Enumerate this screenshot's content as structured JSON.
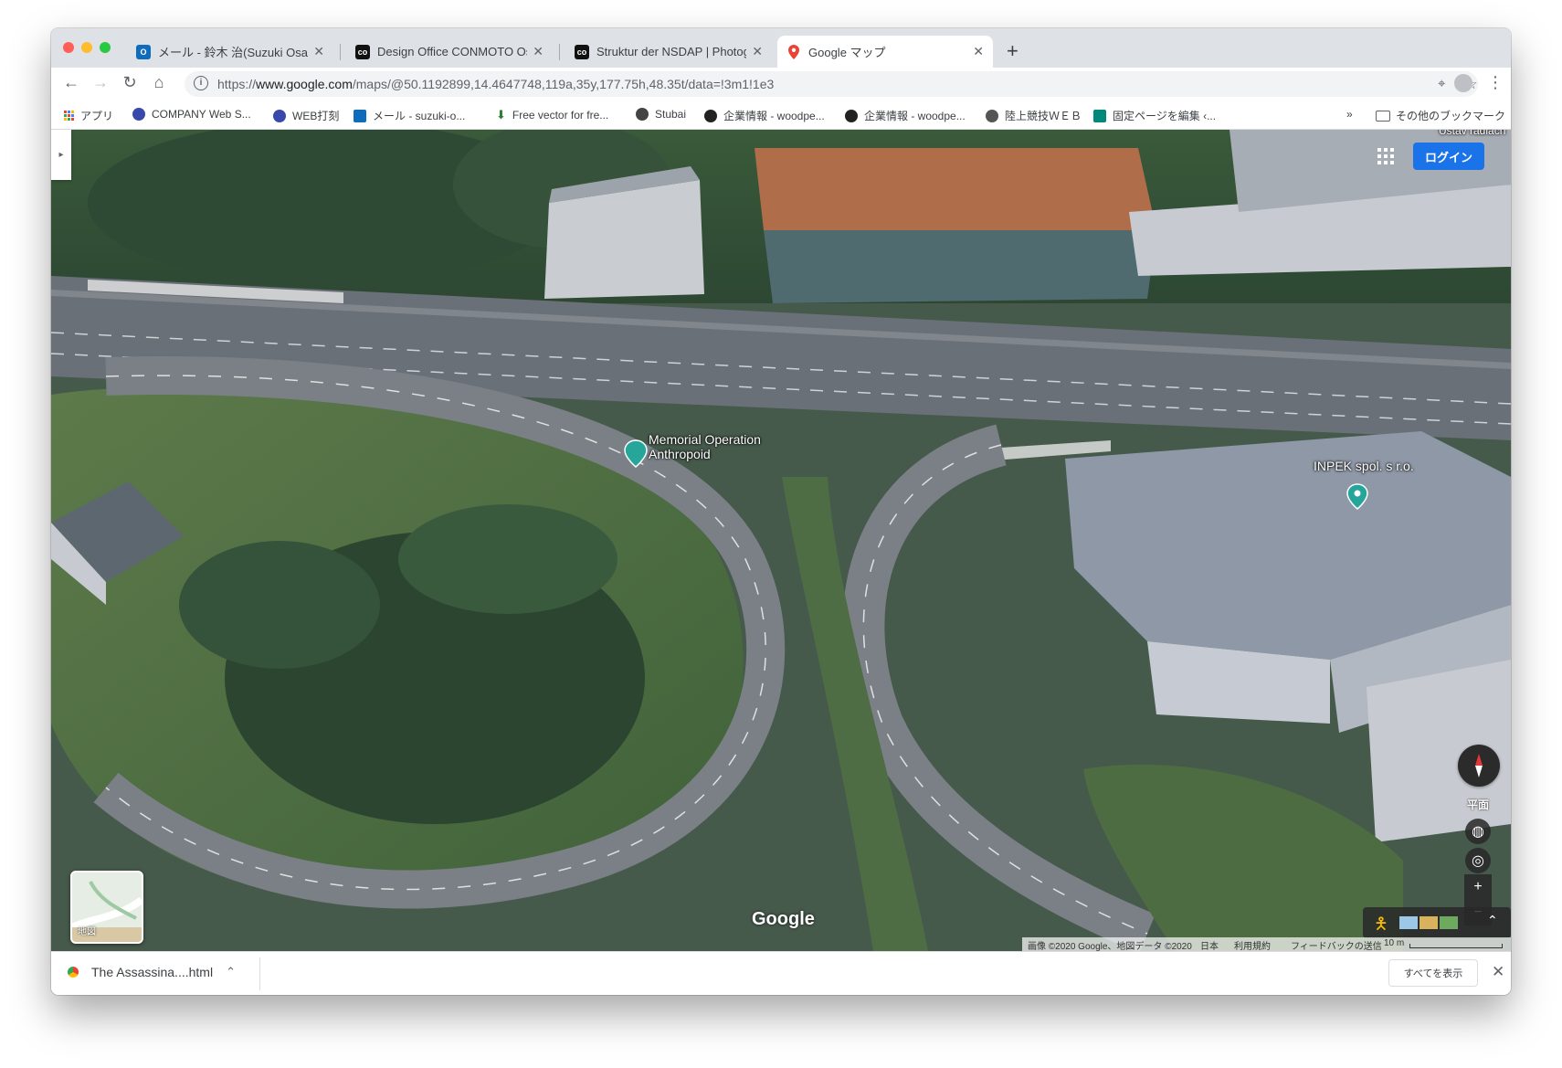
{
  "tabs": [
    {
      "title": "メール - 鈴木 治(Suzuki Osamu)",
      "icon": "outlook-icon",
      "color": "#0f6cbd"
    },
    {
      "title": "Design Office CONMOTO Osamu",
      "icon": "conmoto-icon",
      "color": "#111111"
    },
    {
      "title": "Struktur der NSDAP | Photogra",
      "icon": "conmoto-icon",
      "color": "#111111"
    },
    {
      "title": "Google マップ",
      "icon": "google-maps-icon",
      "color": "#ea4335"
    }
  ],
  "new_tab_label": "+",
  "address_bar": {
    "prefix": "https://",
    "domain": "www.google.com",
    "path": "/maps/@50.1192899,14.4647748,119a,35y,177.75h,48.35t/data=!3m1!1e3"
  },
  "bookmarks": [
    {
      "label": "アプリ",
      "icon": "apps-grid-icon",
      "color": "#4285f4"
    },
    {
      "label": "COMPANY Web S...",
      "icon": "globe-icon",
      "color": "#3949ab"
    },
    {
      "label": "WEB打刻",
      "icon": "globe-icon",
      "color": "#3949ab"
    },
    {
      "label": "メール - suzuki-o...",
      "icon": "outlook-icon",
      "color": "#0f6cbd"
    },
    {
      "label": "Free vector for fre...",
      "icon": "freepik-icon",
      "color": "#2e7d32"
    },
    {
      "label": "Stubai",
      "icon": "globe-icon",
      "color": "#444444"
    },
    {
      "label": "企業情報 - woodpe...",
      "icon": "woodpecker-icon",
      "color": "#222222"
    },
    {
      "label": "企業情報 - woodpe...",
      "icon": "woodpecker-icon",
      "color": "#222222"
    },
    {
      "label": "陸上競技ＷＥＢ",
      "icon": "globe-icon",
      "color": "#555555"
    },
    {
      "label": "固定ページを編集 ‹...",
      "icon": "wp-icon",
      "color": "#00897b"
    }
  ],
  "bookmarks_overflow": "»",
  "other_bookmarks": "その他のブックマーク",
  "map": {
    "login_label": "ログイン",
    "places": [
      {
        "name": "Memorial Operation Anthropoid",
        "line1": "Memorial Operation",
        "line2": "Anthropoid"
      },
      {
        "name": "INPEK spol. s r.o."
      }
    ],
    "corner_text": "Ústav radiach",
    "logo": "Google",
    "layer_label": "地図",
    "plane_label": "平面",
    "zoom_in": "+",
    "zoom_out": "−",
    "attribution": "画像 ©2020 Google、地図データ ©2020",
    "country": "日本",
    "terms": "利用規約",
    "feedback": "フィードバックの送信",
    "scale": "10 m"
  },
  "download": {
    "filename": "The Assassina....html",
    "show_all": "すべてを表示"
  },
  "colors": {
    "accent": "#1a73e8",
    "tab_strip": "#dee1e6",
    "pin": "#26a69a"
  }
}
